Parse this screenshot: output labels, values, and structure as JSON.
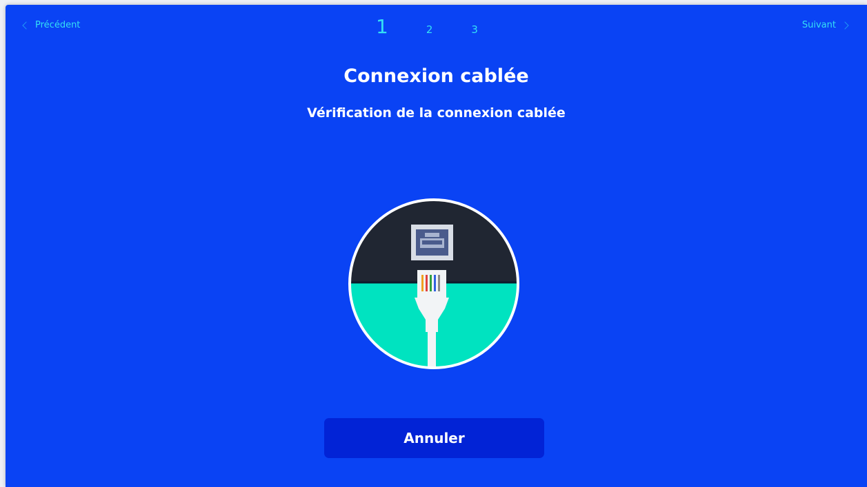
{
  "nav": {
    "prev_label": "Précédent",
    "next_label": "Suivant",
    "prev_icon": "chevron-left-icon",
    "next_icon": "chevron-right-icon"
  },
  "steps": {
    "items": [
      "1",
      "2",
      "3"
    ],
    "active": "1"
  },
  "main": {
    "title": "Connexion cablée",
    "subtitle": "Vérification de la connexion cablée",
    "illustration": "ethernet-cable-icon"
  },
  "actions": {
    "cancel_label": "Annuler"
  },
  "colors": {
    "background": "#0a43f4",
    "accent": "#34e0f4",
    "button": "#0223d6",
    "circle_top": "#202632",
    "circle_bottom": "#00e3c0"
  }
}
